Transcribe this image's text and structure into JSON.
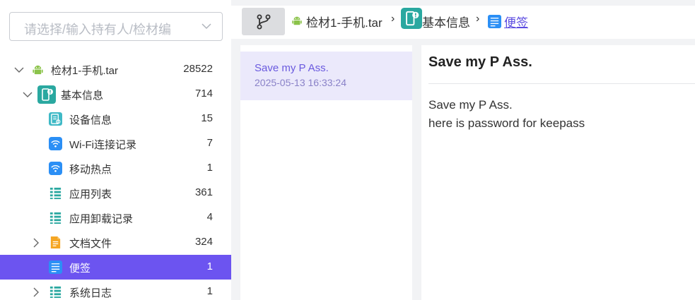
{
  "sidebar": {
    "owner_select_placeholder": "请选择/输入持有人/检材编",
    "tree": [
      {
        "label": "检材1-手机.tar",
        "count": "28522",
        "icon": "android-icon"
      },
      {
        "label": "基本信息",
        "count": "714",
        "icon": "phone-info-icon"
      },
      {
        "label": "设备信息",
        "count": "15",
        "icon": "device-info-icon"
      },
      {
        "label": "Wi-Fi连接记录",
        "count": "7",
        "icon": "wifi-icon"
      },
      {
        "label": "移动热点",
        "count": "1",
        "icon": "wifi-icon"
      },
      {
        "label": "应用列表",
        "count": "361",
        "icon": "list-icon"
      },
      {
        "label": "应用卸载记录",
        "count": "4",
        "icon": "list-icon"
      },
      {
        "label": "文档文件",
        "count": "324",
        "icon": "document-icon"
      },
      {
        "label": "便签",
        "count": "1",
        "icon": "note-icon"
      },
      {
        "label": "系统日志",
        "count": "1",
        "icon": "list-icon"
      }
    ]
  },
  "breadcrumb": {
    "items": [
      "检材1-手机.tar",
      "基本信息",
      "便签"
    ],
    "separator": "›"
  },
  "notes": [
    {
      "title": "Save my P Ass.",
      "date": "2025-05-13 16:33:24"
    }
  ],
  "detail": {
    "title": "Save my P Ass.",
    "lines": [
      "Save my P Ass.",
      "here is password for keepass"
    ]
  },
  "colors": {
    "accent": "#6c54f0",
    "android": "#8bc34a",
    "teal": "#2aa8a0",
    "wifi": "#2b8ff5",
    "doc": "#f5a623"
  }
}
